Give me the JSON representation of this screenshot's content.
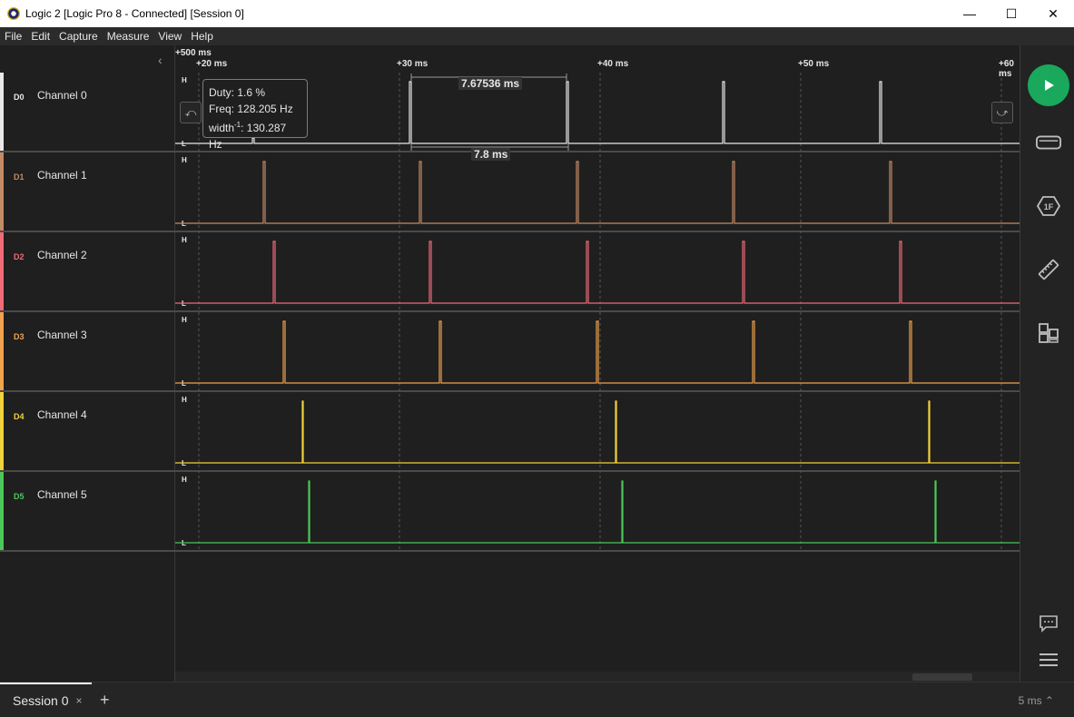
{
  "window": {
    "title": "Logic 2 [Logic Pro 8 - Connected] [Session 0]",
    "minimize": "—",
    "maximize": "☐",
    "close": "✕"
  },
  "menu": [
    "File",
    "Edit",
    "Capture",
    "Measure",
    "View",
    "Help"
  ],
  "timeline": {
    "origin_label": "+500 ms",
    "ticks": [
      "+20 ms",
      "+30 ms",
      "+40 ms",
      "+50 ms",
      "+60 ms"
    ]
  },
  "channels": [
    {
      "tag": "D0",
      "name": "Channel 0",
      "color": "#e8e8e8",
      "tag_color": "#e8e8e8"
    },
    {
      "tag": "D1",
      "name": "Channel 1",
      "color": "#c48a64",
      "tag_color": "#c48a64"
    },
    {
      "tag": "D2",
      "name": "Channel 2",
      "color": "#f06a78",
      "tag_color": "#f06a78"
    },
    {
      "tag": "D3",
      "name": "Channel 3",
      "color": "#f0a24e",
      "tag_color": "#f0a24e"
    },
    {
      "tag": "D4",
      "name": "Channel 4",
      "color": "#f2d23a",
      "tag_color": "#f2d23a"
    },
    {
      "tag": "D5",
      "name": "Channel 5",
      "color": "#4cc85a",
      "tag_color": "#4cc85a"
    }
  ],
  "level_labels": {
    "high": "H",
    "low": "L"
  },
  "tooltip": {
    "duty": "Duty: 1.6 %",
    "freq": "Freq: 128.205 Hz",
    "width_prefix": "width",
    "width_sup": "-1",
    "width_value": ": 130.287 Hz"
  },
  "measurements": {
    "high_width": "7.67536 ms",
    "period": "7.8 ms"
  },
  "session": {
    "tab_label": "Session 0",
    "close": "×",
    "add": "+"
  },
  "zoom_level": "5 ms ⌃",
  "icons": {
    "play": "play-icon",
    "device": "device-icon",
    "analyzer": "analyzer-icon",
    "measure": "ruler-icon",
    "extensions": "extensions-icon",
    "feedback": "chat-icon",
    "menu": "menu-icon"
  }
}
